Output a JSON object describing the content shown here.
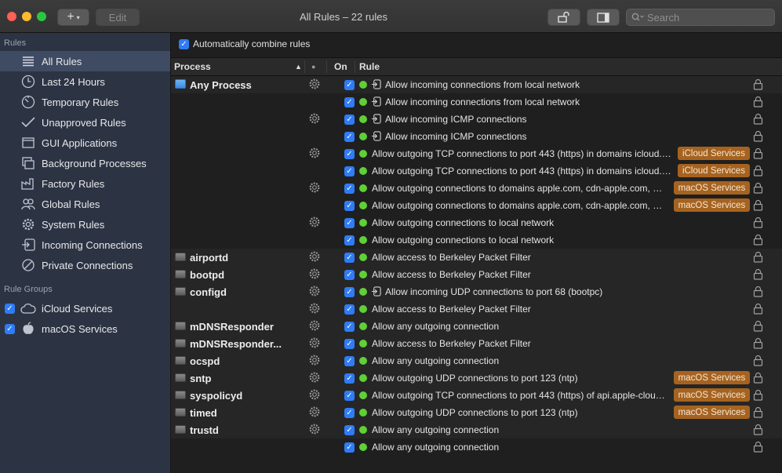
{
  "window": {
    "title": "All Rules  –  22 rules"
  },
  "toolbar": {
    "add_label": "+",
    "edit_label": "Edit",
    "search_placeholder": "Search"
  },
  "sidebar": {
    "rules_header": "Rules",
    "items": [
      {
        "label": "All Rules",
        "icon": "list-icon",
        "selected": true
      },
      {
        "label": "Last 24 Hours",
        "icon": "clock-icon"
      },
      {
        "label": "Temporary Rules",
        "icon": "timer-icon"
      },
      {
        "label": "Unapproved Rules",
        "icon": "checkmark-icon"
      },
      {
        "label": "GUI Applications",
        "icon": "window-icon"
      },
      {
        "label": "Background Processes",
        "icon": "stacked-windows-icon"
      },
      {
        "label": "Factory Rules",
        "icon": "factory-icon"
      },
      {
        "label": "Global Rules",
        "icon": "people-icon"
      },
      {
        "label": "System Rules",
        "icon": "gear-icon"
      },
      {
        "label": "Incoming Connections",
        "icon": "incoming-icon"
      },
      {
        "label": "Private Connections",
        "icon": "no-entry-icon"
      }
    ],
    "groups_header": "Rule Groups",
    "groups": [
      {
        "label": "iCloud Services",
        "icon": "cloud-icon",
        "checked": true
      },
      {
        "label": "macOS Services",
        "icon": "apple-icon",
        "checked": true
      }
    ]
  },
  "main": {
    "combine_label": "Automatically combine rules",
    "columns": {
      "process": "Process",
      "status": "●",
      "on": "On",
      "rule": "Rule"
    },
    "rows": [
      {
        "process": "Any Process",
        "gear": true,
        "incoming": true,
        "rule": "Allow incoming connections from local network",
        "tag": ""
      },
      {
        "process": "",
        "gear": false,
        "incoming": true,
        "rule": "Allow incoming connections from local network",
        "tag": ""
      },
      {
        "process": "",
        "gear": true,
        "incoming": true,
        "rule": "Allow incoming ICMP connections",
        "tag": ""
      },
      {
        "process": "",
        "gear": false,
        "incoming": true,
        "rule": "Allow incoming ICMP connections",
        "tag": ""
      },
      {
        "process": "",
        "gear": true,
        "incoming": false,
        "rule": "Allow outgoing TCP connections to port 443 (https) in domains icloud.co...",
        "tag": "iCloud Services"
      },
      {
        "process": "",
        "gear": false,
        "incoming": false,
        "rule": "Allow outgoing TCP connections to port 443 (https) in domains icloud.co...",
        "tag": "iCloud Services"
      },
      {
        "process": "",
        "gear": true,
        "incoming": false,
        "rule": "Allow outgoing connections to domains apple.com, cdn-apple.com, mzst...",
        "tag": "macOS Services"
      },
      {
        "process": "",
        "gear": false,
        "incoming": false,
        "rule": "Allow outgoing connections to domains apple.com, cdn-apple.com, mzst...",
        "tag": "macOS Services"
      },
      {
        "process": "",
        "gear": true,
        "incoming": false,
        "rule": "Allow outgoing connections to local network",
        "tag": ""
      },
      {
        "process": "",
        "gear": false,
        "incoming": false,
        "rule": "Allow outgoing connections to local network",
        "tag": ""
      },
      {
        "process": "airportd",
        "gear": true,
        "incoming": false,
        "rule": "Allow access to Berkeley Packet Filter",
        "tag": ""
      },
      {
        "process": "bootpd",
        "gear": true,
        "incoming": false,
        "rule": "Allow access to Berkeley Packet Filter",
        "tag": ""
      },
      {
        "process": "configd",
        "gear": true,
        "incoming": true,
        "rule": "Allow incoming UDP connections to port 68 (bootpc)",
        "tag": ""
      },
      {
        "process": "",
        "gear": true,
        "incoming": false,
        "rule": "Allow access to Berkeley Packet Filter",
        "tag": ""
      },
      {
        "process": "mDNSResponder",
        "gear": true,
        "incoming": false,
        "rule": "Allow any outgoing connection",
        "tag": ""
      },
      {
        "process": "mDNSResponder...",
        "gear": true,
        "incoming": false,
        "rule": "Allow access to Berkeley Packet Filter",
        "tag": ""
      },
      {
        "process": "ocspd",
        "gear": true,
        "incoming": false,
        "rule": "Allow any outgoing connection",
        "tag": ""
      },
      {
        "process": "sntp",
        "gear": true,
        "incoming": false,
        "rule": "Allow outgoing UDP connections to port 123 (ntp)",
        "tag": "macOS Services"
      },
      {
        "process": "syspolicyd",
        "gear": true,
        "incoming": false,
        "rule": "Allow outgoing TCP connections to port 443 (https) of api.apple-cloudki...",
        "tag": "macOS Services"
      },
      {
        "process": "timed",
        "gear": true,
        "incoming": false,
        "rule": "Allow outgoing UDP connections to port 123 (ntp)",
        "tag": "macOS Services"
      },
      {
        "process": "trustd",
        "gear": true,
        "incoming": false,
        "rule": "Allow any outgoing connection",
        "tag": ""
      },
      {
        "process": "",
        "gear": false,
        "incoming": false,
        "rule": "Allow any outgoing connection",
        "tag": ""
      }
    ]
  },
  "colors": {
    "accent": "#2f7cf6",
    "tag": "#a6631f",
    "status_green": "#5fd035"
  }
}
